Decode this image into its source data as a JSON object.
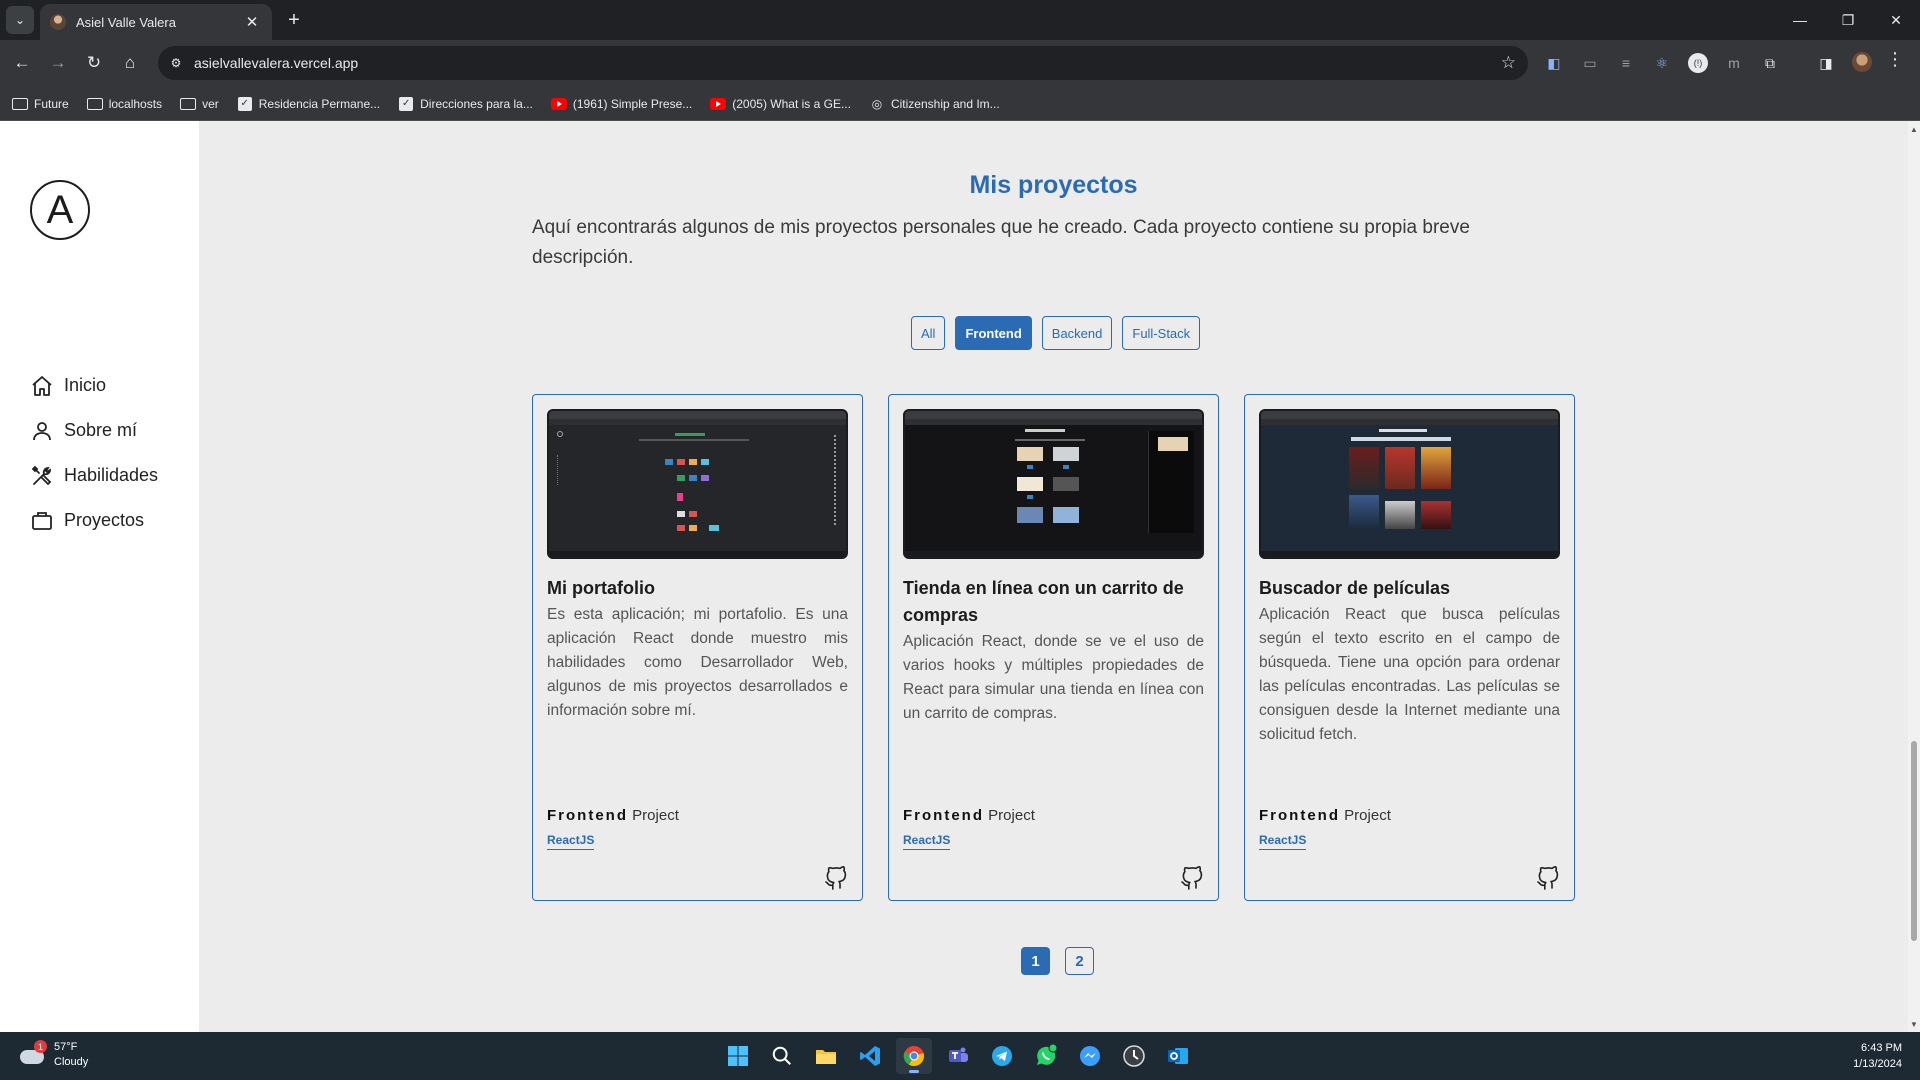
{
  "browser": {
    "tab_title": "Asiel Valle Valera",
    "url": "asielvallevalera.vercel.app",
    "bookmarks": [
      {
        "label": "Future",
        "icon": "folder-icon"
      },
      {
        "label": "localhosts",
        "icon": "folder-icon"
      },
      {
        "label": "ver",
        "icon": "folder-icon"
      },
      {
        "label": "Residencia Permane...",
        "icon": "doc-icon"
      },
      {
        "label": "Direcciones para la...",
        "icon": "doc-icon"
      },
      {
        "label": "(1961) Simple Prese...",
        "icon": "youtube-icon"
      },
      {
        "label": "(2005) What is a GE...",
        "icon": "youtube-icon"
      },
      {
        "label": "Citizenship and Im...",
        "icon": "globe-icon"
      }
    ]
  },
  "sidebar": {
    "logo_letter": "A",
    "items": [
      {
        "label": "Inicio",
        "icon": "home-icon"
      },
      {
        "label": "Sobre mí",
        "icon": "user-icon"
      },
      {
        "label": "Habilidades",
        "icon": "tools-icon"
      },
      {
        "label": "Proyectos",
        "icon": "briefcase-icon"
      }
    ]
  },
  "main": {
    "title": "Mis proyectos",
    "description": "Aquí encontrarás algunos de mis proyectos personales que he creado. Cada proyecto contiene su propia breve descripción.",
    "filters": [
      "All",
      "Frontend",
      "Backend",
      "Full-Stack"
    ],
    "active_filter": "Frontend",
    "projects": [
      {
        "title": "Mi portafolio",
        "description": "Es esta aplicación; mi portafolio. Es una aplicación React donde muestro mis habilidades como Desarrollador Web, algunos de mis proyectos desarrollados e información sobre mí.",
        "type": "Frontend",
        "type_suffix": "Project",
        "tech": "ReactJS"
      },
      {
        "title": "Tienda en línea con un carrito de compras",
        "description": "Aplicación React, donde se ve el uso de varios hooks y múltiples propiedades de React para simular una tienda en línea con un carrito de compras.",
        "type": "Frontend",
        "type_suffix": "Project",
        "tech": "ReactJS"
      },
      {
        "title": "Buscador de películas",
        "description": "Aplicación React que busca películas según el texto escrito en el campo de búsqueda. Tiene una opción para ordenar las películas encontradas. Las películas se consiguen desde la Internet mediante una solicitud fetch.",
        "type": "Frontend",
        "type_suffix": "Project",
        "tech": "ReactJS"
      }
    ],
    "pages": [
      "1",
      "2"
    ],
    "active_page": "1"
  },
  "right_icons": [
    "moon-icon",
    "translate-icon",
    "paint-roller-icon",
    "instagram-icon",
    "linkedin-icon",
    "github-icon",
    "whatsapp-icon",
    "mail-icon"
  ],
  "taskbar": {
    "weather_temp": "57°F",
    "weather_desc": "Cloudy",
    "weather_badge": "1",
    "time": "6:43 PM",
    "date": "1/13/2024"
  },
  "colors": {
    "accent": "#2a6bb3",
    "page_bg": "#ececec",
    "sidebar_bg": "#ffffff"
  }
}
